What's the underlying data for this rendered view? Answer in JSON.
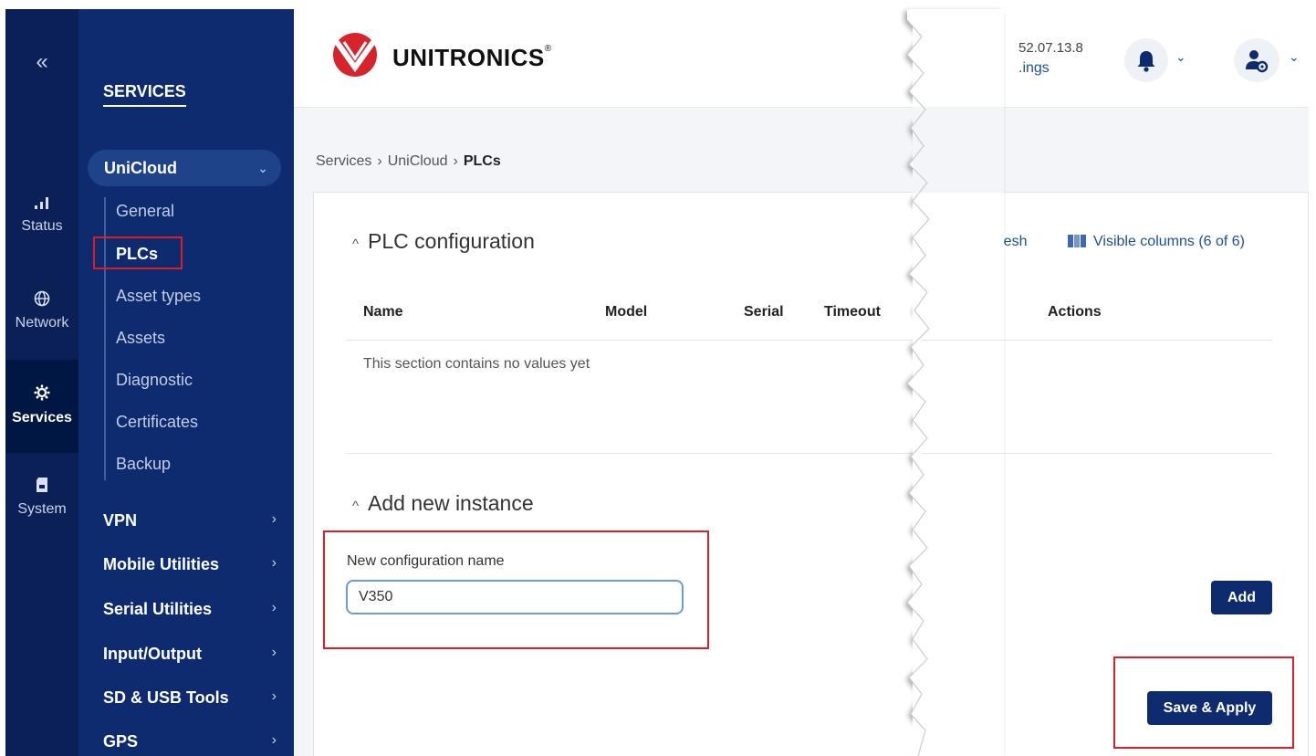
{
  "rail": {
    "collapse_glyph": "«",
    "items": [
      {
        "label": "Status",
        "icon": "signal-icon"
      },
      {
        "label": "Network",
        "icon": "globe-icon"
      },
      {
        "label": "Services",
        "icon": "gear-icon",
        "active": true
      },
      {
        "label": "System",
        "icon": "sd-card-icon"
      }
    ]
  },
  "menu": {
    "title": "SERVICES",
    "expanded": {
      "label": "UniCloud"
    },
    "sub_items": [
      "General",
      "PLCs",
      "Asset types",
      "Assets",
      "Diagnostic",
      "Certificates",
      "Backup"
    ],
    "active_sub": "PLCs",
    "groups": [
      "VPN",
      "Mobile Utilities",
      "Serial Utilities",
      "Input/Output",
      "SD & USB Tools",
      "GPS"
    ]
  },
  "header": {
    "brand": "UNITRONICS",
    "brand_mark": "®",
    "version_fragment": "52.07.13.8",
    "link_fragment": ".ings"
  },
  "breadcrumb": {
    "items": [
      "Services",
      "UniCloud",
      "PLCs"
    ],
    "separator": "›"
  },
  "plc_config": {
    "title": "PLC configuration",
    "refresh_fragment": "efresh",
    "visible_columns": "Visible columns (6 of 6)",
    "columns": [
      "Name",
      "Model",
      "Serial",
      "Timeout",
      "Actions"
    ],
    "empty_text": "This section contains no values yet"
  },
  "add_instance": {
    "title": "Add new instance",
    "field_label": "New configuration name",
    "field_value": "V350",
    "add_label": "Add",
    "save_label": "Save & Apply"
  },
  "colors": {
    "rail": "#0a2057",
    "menu": "#0d2b6e",
    "accent": "#1a4fa3",
    "highlight": "#e01d25",
    "brand_red": "#d7232b"
  }
}
